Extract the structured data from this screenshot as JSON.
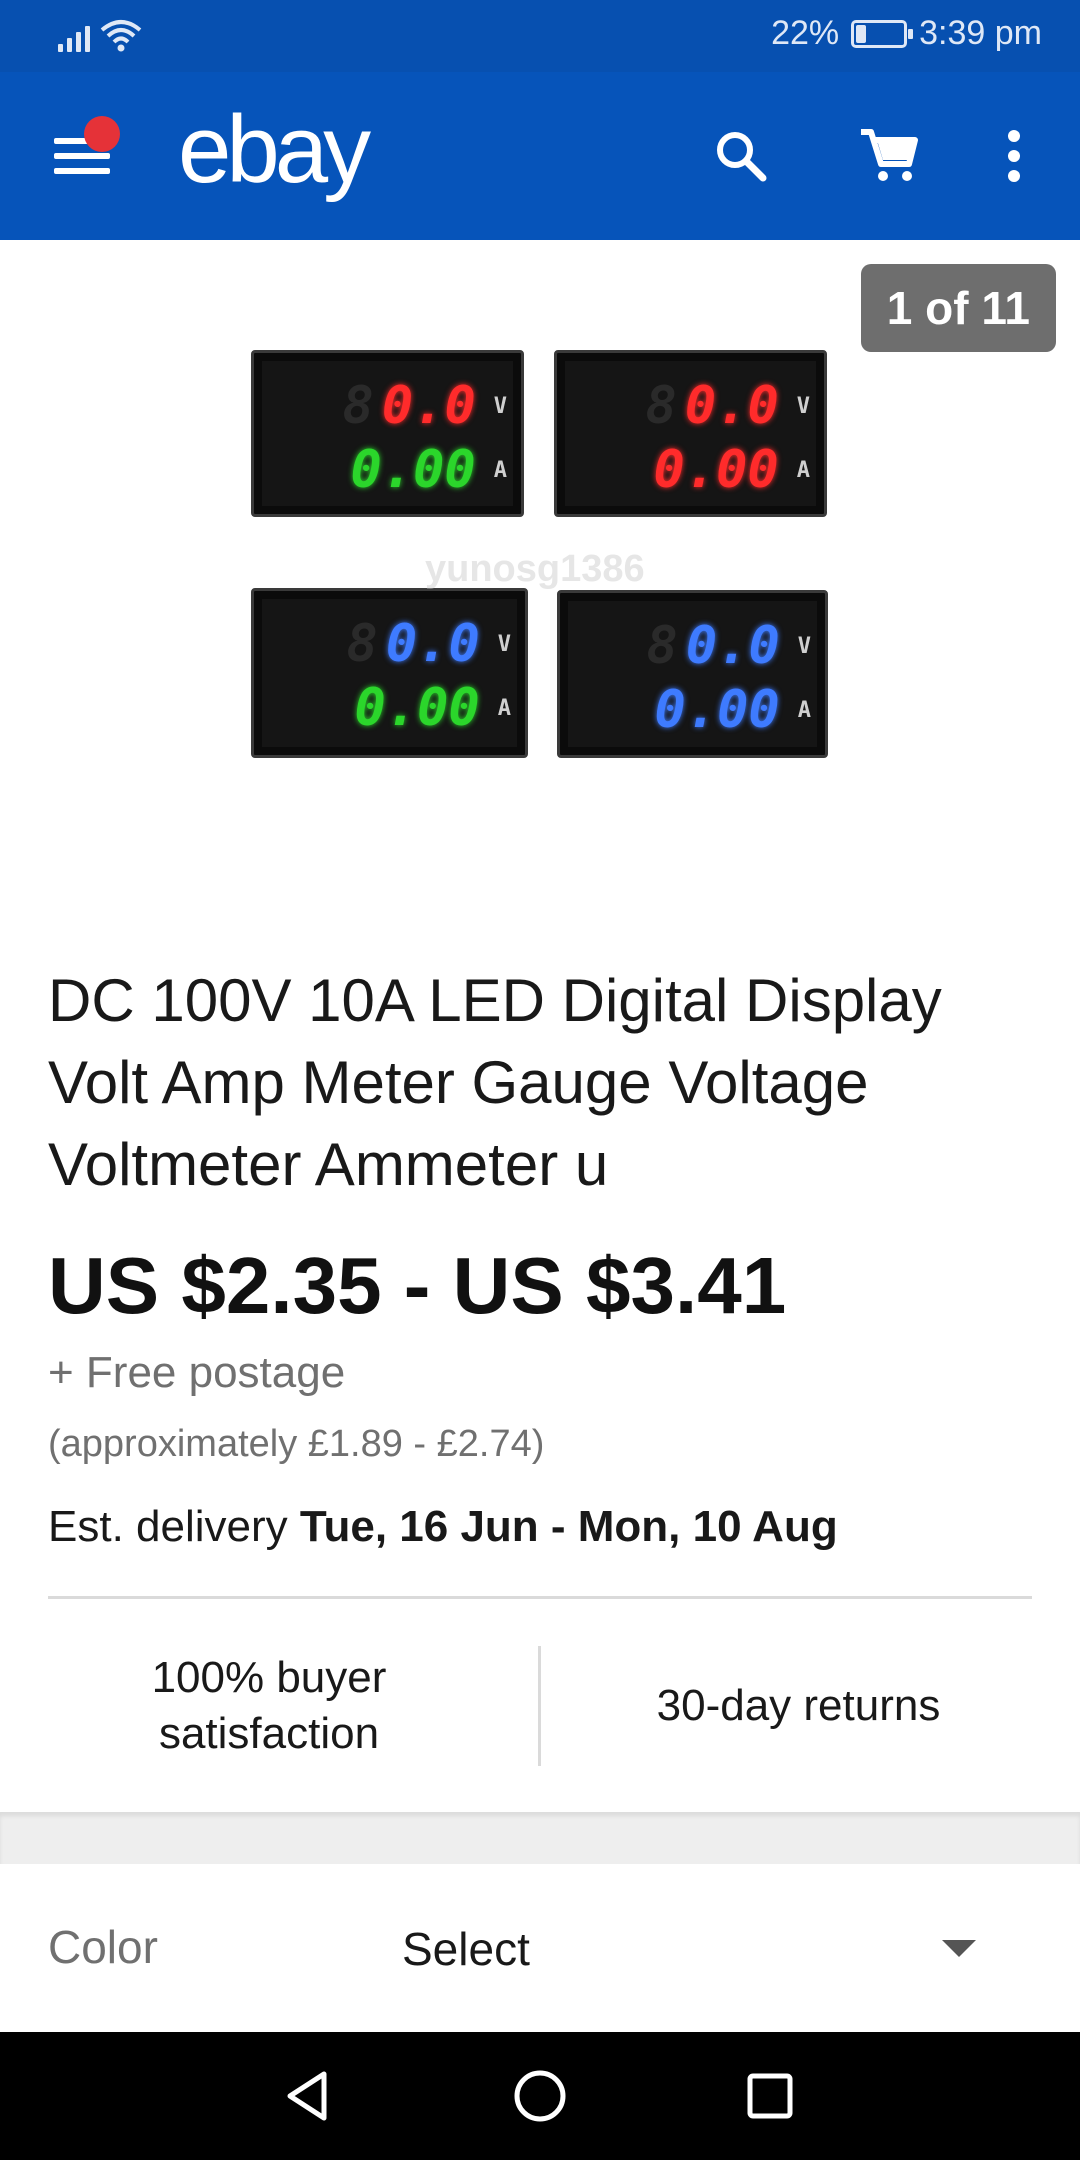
{
  "status_bar": {
    "battery": "22%",
    "battery_level": 0.22,
    "time": "3:39 pm",
    "color": "#0750b0"
  },
  "app_bar": {
    "logo": "ebay",
    "color": "#0654ba",
    "icons": [
      "menu-icon",
      "notification-dot",
      "search-icon",
      "cart-icon",
      "more-icon"
    ]
  },
  "gallery": {
    "counter": "1 of 11",
    "watermark": "yunosg1386",
    "meters": [
      {
        "volts": "0.0",
        "amps": "0.00",
        "volt_color": "#ff2b2b",
        "amp_color": "#2bd62b",
        "volt_unit": "V",
        "amp_unit": "A"
      },
      {
        "volts": "0.0",
        "amps": "0.00",
        "volt_color": "#ff2b2b",
        "amp_color": "#ff2b2b",
        "volt_unit": "V",
        "amp_unit": "A"
      },
      {
        "volts": "0.0",
        "amps": "0.00",
        "volt_color": "#3e7bff",
        "amp_color": "#2bd62b",
        "volt_unit": "V",
        "amp_unit": "A"
      },
      {
        "volts": "0.0",
        "amps": "0.00",
        "volt_color": "#3e7bff",
        "amp_color": "#3e7bff",
        "volt_unit": "V",
        "amp_unit": "A"
      }
    ]
  },
  "listing": {
    "title": "DC 100V 10A LED Digital Display Volt Amp Meter Gauge Voltage Voltmeter Ammeter u",
    "price": "US $2.35 - US $3.41",
    "postage": "+ Free postage",
    "approx": "(approximately £1.89 - £2.74)",
    "delivery_label": "Est. delivery",
    "delivery_dates": "Tue, 16 Jun - Mon, 10 Aug"
  },
  "trust": {
    "satisfaction_line1": "100% buyer",
    "satisfaction_line2": "satisfaction",
    "returns": "30-day returns"
  },
  "variation": {
    "label": "Color",
    "value": "Select"
  },
  "nav_bar": {
    "buttons": [
      "back-icon",
      "home-icon",
      "recents-icon"
    ]
  }
}
